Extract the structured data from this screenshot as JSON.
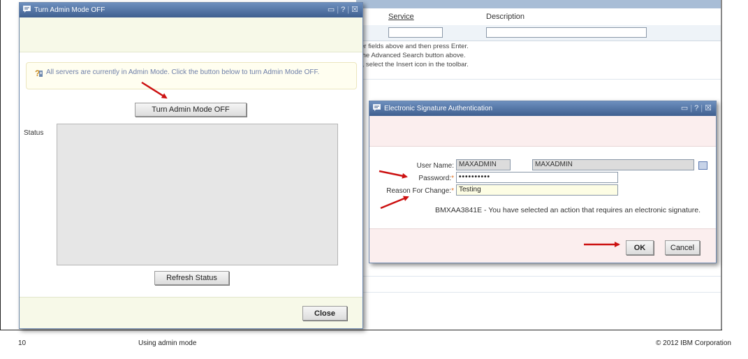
{
  "background_app": {
    "columns": {
      "service": "Service",
      "description": "Description"
    },
    "messages": [
      "er fields above and then press Enter.",
      " the Advanced Search button above.",
      "I, select the Insert icon in the toolbar."
    ]
  },
  "dialog_admin": {
    "title": "Turn Admin Mode OFF",
    "controls": {
      "minimize": "▭",
      "help": "?",
      "close": "☒"
    },
    "info_message": "All servers are currently in Admin Mode. Click the button below to turn Admin Mode OFF.",
    "turn_off_button": "Turn Admin Mode OFF",
    "status_label": "Status",
    "status_value": "",
    "refresh_button": "Refresh Status",
    "close_button": "Close"
  },
  "dialog_esig": {
    "title": "Electronic Signature Authentication",
    "controls": {
      "minimize": "▭",
      "help": "?",
      "close": "☒"
    },
    "user_name_label": "User Name:",
    "user_name_value": "MAXADMIN",
    "user_display_name": "MAXADMIN",
    "password_label": "Password:",
    "password_value": "••••••••••",
    "reason_label": "Reason For Change:",
    "reason_value": "Testing",
    "message": "BMXAA3841E - You have selected an action that requires an electronic signature.",
    "ok_button": "OK",
    "cancel_button": "Cancel"
  },
  "slide_footer": {
    "page_number": "10",
    "title": "Using admin mode",
    "copyright": "© 2012 IBM Corporation"
  },
  "colors": {
    "titlebar": "#4a6a9a",
    "arrow": "#cc1111",
    "required": "#e07020",
    "info_text": "#6e7fa8"
  },
  "icons": [
    "dialog-icon",
    "info-icon",
    "lookup-icon",
    "arrow-annotation"
  ]
}
